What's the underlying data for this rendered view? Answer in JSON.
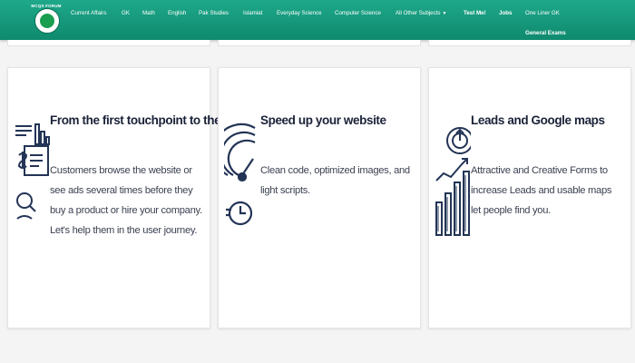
{
  "nav": {
    "logo_text": "MCQS FORUM",
    "items": [
      {
        "label": "Current Affairs"
      },
      {
        "label": "GK"
      },
      {
        "label": "Math"
      },
      {
        "label": "English"
      },
      {
        "label": "Pak Studies"
      },
      {
        "label": "Islamiat"
      },
      {
        "label": "Everyday Science"
      },
      {
        "label": "Computer Science"
      },
      {
        "label": "All Other Subjects"
      },
      {
        "label": "Test Me!"
      },
      {
        "label": "Jobs"
      },
      {
        "label": "One Liner GK"
      }
    ],
    "second_row": "General Exams",
    "colors": {
      "bar": "#15967a",
      "text": "#ffffff"
    }
  },
  "cards": [
    {
      "icon": "customer-journey-icon",
      "title": "From the first touchpoint to the sale",
      "text": "Customers browse the website or see ads several times before they buy a product or hire your company. Let's help them in the user journey."
    },
    {
      "icon": "speedometer-icon",
      "title": "Speed up your website",
      "text": "Clean code, optimized images, and light scripts."
    },
    {
      "icon": "growth-chart-icon",
      "title": "Leads and Google maps",
      "text": "Attractive and Creative Forms to increase Leads and usable maps let people find you."
    }
  ],
  "colors": {
    "icon": "#233456",
    "title": "#1a2238",
    "background": "#f4f4f4"
  }
}
